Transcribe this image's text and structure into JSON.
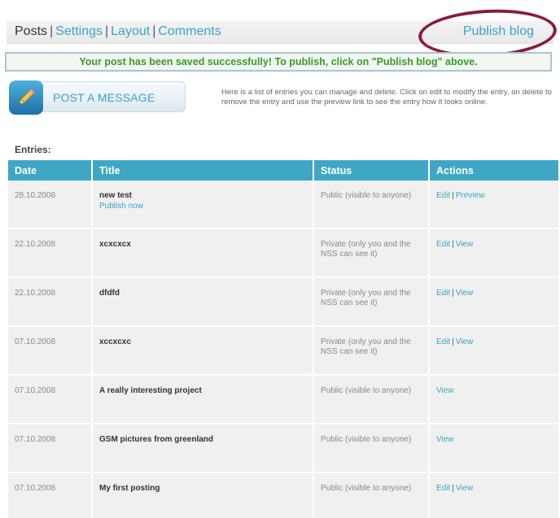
{
  "nav": {
    "tabs": [
      {
        "label": "Posts",
        "active": true
      },
      {
        "label": "Settings"
      },
      {
        "label": "Layout"
      },
      {
        "label": "Comments"
      }
    ],
    "separator": "|",
    "publish_label": "Publish blog"
  },
  "notice": "Your post has been saved successfully! To publish, click on \"Publish blog\" above.",
  "post_button_label": "POST A MESSAGE",
  "help_text": "Here is a list of entries you can manage and delete. Click on edit to modify the entry, on delete to remove the entry and use the preview link to see the entry how it looks online.",
  "entries": {
    "title": "Entries:",
    "columns": [
      "Date",
      "Title",
      "Status",
      "Actions"
    ],
    "action_separator": "|",
    "rows": [
      {
        "date": "28.10.2008",
        "title": "new test",
        "sub": "Publish now",
        "status": "Public (visible to anyone)",
        "actions": [
          "Edit",
          "Preview"
        ]
      },
      {
        "date": "22.10.2008",
        "title": "xcxcxcx",
        "status": "Private (only you and the NSS can see it)",
        "actions": [
          "Edit",
          "View"
        ]
      },
      {
        "date": "22.10.2008",
        "title": "dfdfd",
        "status": "Private (only you and the NSS can see it)",
        "actions": [
          "Edit",
          "View"
        ]
      },
      {
        "date": "07.10.2008",
        "title": "xccxcxc",
        "status": "Private (only you and the NSS can see it)",
        "actions": [
          "Edit",
          "View"
        ]
      },
      {
        "date": "07.10.2008",
        "title": "A really interesting project",
        "status": "Public (visible to anyone)",
        "actions": [
          "View"
        ]
      },
      {
        "date": "07.10.2008",
        "title": "GSM pictures from greenland",
        "status": "Public (visible to anyone)",
        "actions": [
          "View"
        ]
      },
      {
        "date": "07.10.2008",
        "title": "My first posting",
        "status": "Public (visible to anyone)",
        "actions": [
          "Edit",
          "View"
        ]
      }
    ]
  },
  "colors": {
    "accent": "#3aa3c9",
    "header": "#3fa7c4",
    "success_text": "#3a9a2a",
    "annotation_ring": "#8a1b3d"
  },
  "icons": {
    "post_button": "pencil-icon"
  }
}
